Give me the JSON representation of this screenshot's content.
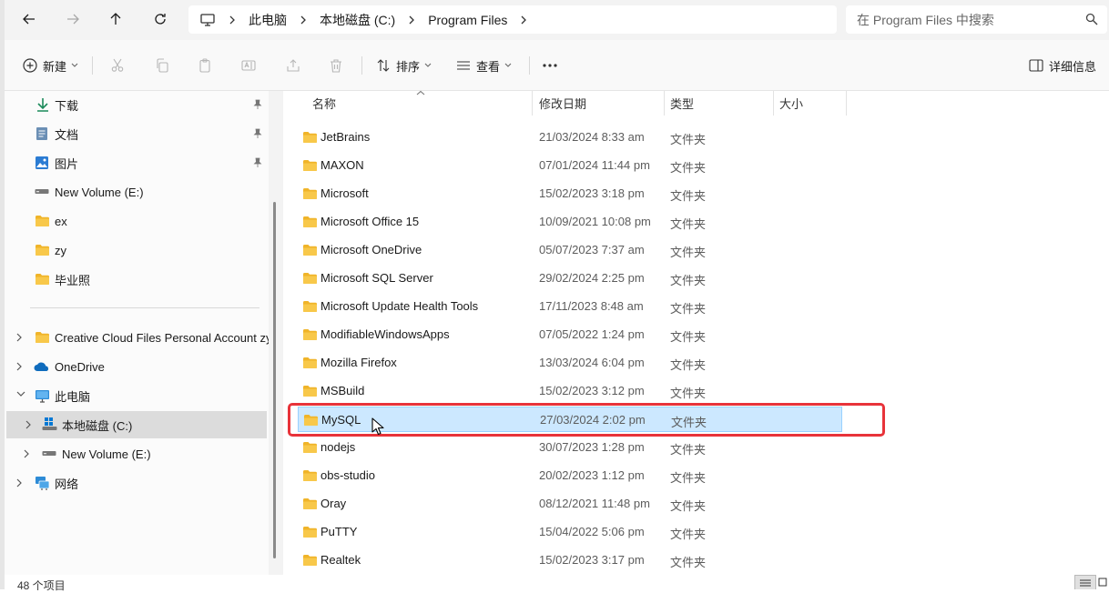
{
  "address": {
    "crumbs": [
      "此电脑",
      "本地磁盘 (C:)",
      "Program Files"
    ],
    "search_placeholder": "在 Program Files 中搜索"
  },
  "toolbar": {
    "new_label": "新建",
    "sort_label": "排序",
    "view_label": "查看",
    "details_label": "详细信息"
  },
  "nav": {
    "quick": [
      {
        "label": "下载",
        "icon": "download-icon"
      },
      {
        "label": "文档",
        "icon": "document-icon"
      },
      {
        "label": "图片",
        "icon": "pictures-icon"
      },
      {
        "label": "New Volume (E:)",
        "icon": "drive-icon"
      },
      {
        "label": "ex",
        "icon": "folder-icon"
      },
      {
        "label": "zy",
        "icon": "folder-icon"
      },
      {
        "label": "毕业照",
        "icon": "folder-icon"
      }
    ],
    "tree": [
      {
        "label": "Creative Cloud Files Personal Account zy",
        "icon": "folder-icon"
      },
      {
        "label": "OneDrive",
        "icon": "onedrive-icon"
      },
      {
        "label": "此电脑",
        "icon": "computer-icon"
      },
      {
        "label": "本地磁盘 (C:)",
        "icon": "windows-drive-icon"
      },
      {
        "label": "New Volume (E:)",
        "icon": "drive-icon"
      },
      {
        "label": "网络",
        "icon": "network-icon"
      }
    ]
  },
  "columns": {
    "name": "名称",
    "date": "修改日期",
    "type": "类型",
    "size": "大小"
  },
  "files": [
    {
      "name": "JetBrains",
      "date": "21/03/2024 8:33 am",
      "type": "文件夹"
    },
    {
      "name": "MAXON",
      "date": "07/01/2024 11:44 pm",
      "type": "文件夹"
    },
    {
      "name": "Microsoft",
      "date": "15/02/2023 3:18 pm",
      "type": "文件夹"
    },
    {
      "name": "Microsoft Office 15",
      "date": "10/09/2021 10:08 pm",
      "type": "文件夹"
    },
    {
      "name": "Microsoft OneDrive",
      "date": "05/07/2023 7:37 am",
      "type": "文件夹"
    },
    {
      "name": "Microsoft SQL Server",
      "date": "29/02/2024 2:25 pm",
      "type": "文件夹"
    },
    {
      "name": "Microsoft Update Health Tools",
      "date": "17/11/2023 8:48 am",
      "type": "文件夹"
    },
    {
      "name": "ModifiableWindowsApps",
      "date": "07/05/2022 1:24 pm",
      "type": "文件夹"
    },
    {
      "name": "Mozilla Firefox",
      "date": "13/03/2024 6:04 pm",
      "type": "文件夹"
    },
    {
      "name": "MSBuild",
      "date": "15/02/2023 3:12 pm",
      "type": "文件夹"
    },
    {
      "name": "MySQL",
      "date": "27/03/2024 2:02 pm",
      "type": "文件夹"
    },
    {
      "name": "nodejs",
      "date": "30/07/2023 1:28 pm",
      "type": "文件夹"
    },
    {
      "name": "obs-studio",
      "date": "20/02/2023 1:12 pm",
      "type": "文件夹"
    },
    {
      "name": "Oray",
      "date": "08/12/2021 11:48 pm",
      "type": "文件夹"
    },
    {
      "name": "PuTTY",
      "date": "15/04/2022 5:06 pm",
      "type": "文件夹"
    },
    {
      "name": "Realtek",
      "date": "15/02/2023 3:17 pm",
      "type": "文件夹"
    }
  ],
  "selected_file": "MySQL",
  "status": {
    "count": "48 个项目"
  },
  "colors": {
    "folder": "#f8c84a",
    "selection": "#cce8ff",
    "highlight_box": "#e8333a",
    "accent": "#0067c0"
  }
}
